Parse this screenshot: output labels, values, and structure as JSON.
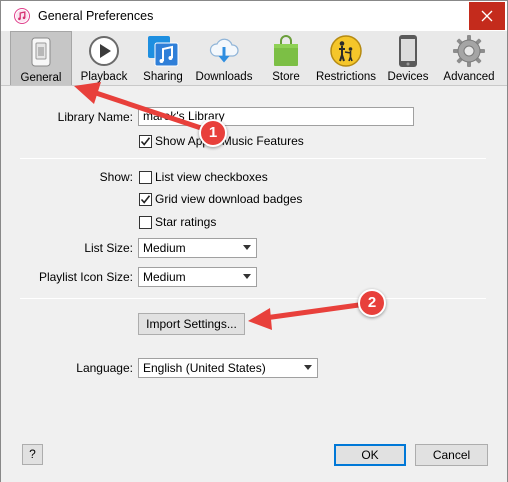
{
  "window": {
    "title": "General Preferences"
  },
  "toolbar": {
    "items": [
      {
        "label": "General",
        "icon": "general-switch-icon",
        "selected": true
      },
      {
        "label": "Playback",
        "icon": "play-icon",
        "selected": false
      },
      {
        "label": "Sharing",
        "icon": "sharing-music-icon",
        "selected": false
      },
      {
        "label": "Downloads",
        "icon": "cloud-download-icon",
        "selected": false
      },
      {
        "label": "Store",
        "icon": "store-bag-icon",
        "selected": false
      },
      {
        "label": "Restrictions",
        "icon": "restrictions-parental-icon",
        "selected": false
      },
      {
        "label": "Devices",
        "icon": "device-phone-icon",
        "selected": false
      },
      {
        "label": "Advanced",
        "icon": "gear-icon",
        "selected": false
      }
    ]
  },
  "general": {
    "library_name_label": "Library Name:",
    "library_name_value": "marek's Library",
    "show_apple_music_label": "Show Apple Music Features",
    "show_apple_music_checked": true,
    "show_label": "Show:",
    "list_view_checkboxes_label": "List view checkboxes",
    "list_view_checkboxes_checked": false,
    "grid_view_badges_label": "Grid view download badges",
    "grid_view_badges_checked": true,
    "star_ratings_label": "Star ratings",
    "star_ratings_checked": false,
    "list_size_label": "List Size:",
    "list_size_value": "Medium",
    "playlist_icon_size_label": "Playlist Icon Size:",
    "playlist_icon_size_value": "Medium",
    "import_settings_label": "Import Settings...",
    "language_label": "Language:",
    "language_value": "English (United States)"
  },
  "footer": {
    "help_label": "?",
    "ok_label": "OK",
    "cancel_label": "Cancel"
  },
  "annotations": {
    "badge_1": "1",
    "badge_2": "2",
    "arrow_color": "#e8403b"
  }
}
